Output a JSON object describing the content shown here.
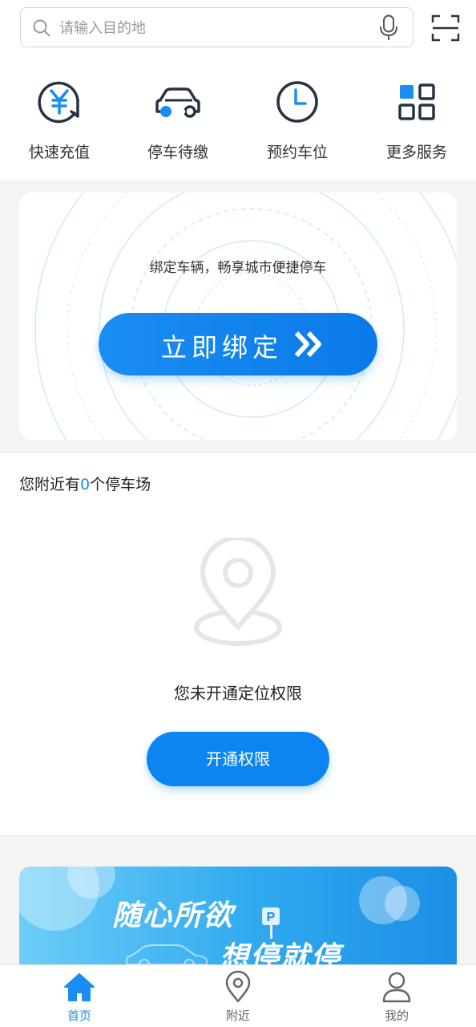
{
  "search": {
    "placeholder": "请输入目的地",
    "value": ""
  },
  "services": [
    {
      "label": "快速充值",
      "icon": "yuan-recharge-icon"
    },
    {
      "label": "停车待缴",
      "icon": "car-icon"
    },
    {
      "label": "预约车位",
      "icon": "clock-icon"
    },
    {
      "label": "更多服务",
      "icon": "grid-icon"
    }
  ],
  "bind": {
    "tagline": "绑定车辆，畅享城市便捷停车",
    "button_label": "立即绑定"
  },
  "nearby": {
    "prefix": "您附近有",
    "count": "0",
    "suffix": "个停车场",
    "no_permission": "您未开通定位权限",
    "enable_button": "开通权限"
  },
  "banner": {
    "line1": "随心所欲",
    "line2": "想停就停",
    "parking_mark": "P"
  },
  "tabbar": [
    {
      "label": "首页",
      "icon": "home-icon",
      "active": true
    },
    {
      "label": "附近",
      "icon": "location-pin-icon",
      "active": false
    },
    {
      "label": "我的",
      "icon": "user-icon",
      "active": false
    }
  ],
  "colors": {
    "accent": "#1a8df2",
    "icon_dark": "#263343",
    "background_gap": "#f4f4f4"
  }
}
